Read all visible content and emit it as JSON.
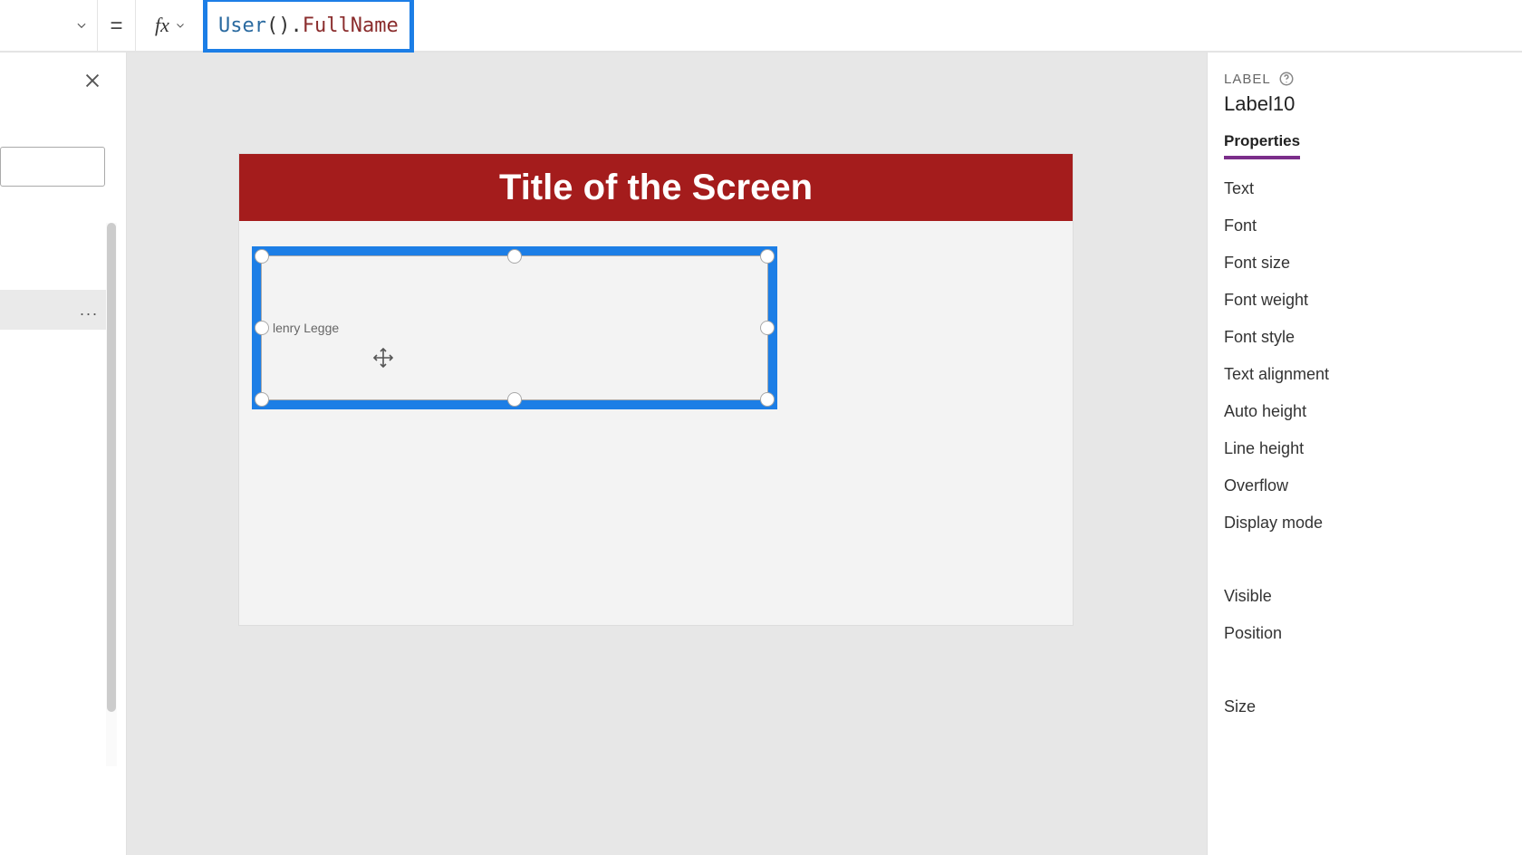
{
  "formula_bar": {
    "equals": "=",
    "fx": "fx",
    "token_obj": "User",
    "token_paren_open": "(",
    "token_paren_close": ")",
    "token_dot": ".",
    "token_prop": "FullName"
  },
  "tree": {
    "more_actions": "..."
  },
  "canvas": {
    "screen_title": "Title of the Screen",
    "label_value": "lenry Legge"
  },
  "props": {
    "header": "LABEL",
    "control_name": "Label10",
    "tab_properties": "Properties",
    "items": {
      "text": "Text",
      "font": "Font",
      "font_size": "Font size",
      "font_weight": "Font weight",
      "font_style": "Font style",
      "text_alignment": "Text alignment",
      "auto_height": "Auto height",
      "line_height": "Line height",
      "overflow": "Overflow",
      "display_mode": "Display mode",
      "visible": "Visible",
      "position": "Position",
      "size": "Size"
    }
  }
}
